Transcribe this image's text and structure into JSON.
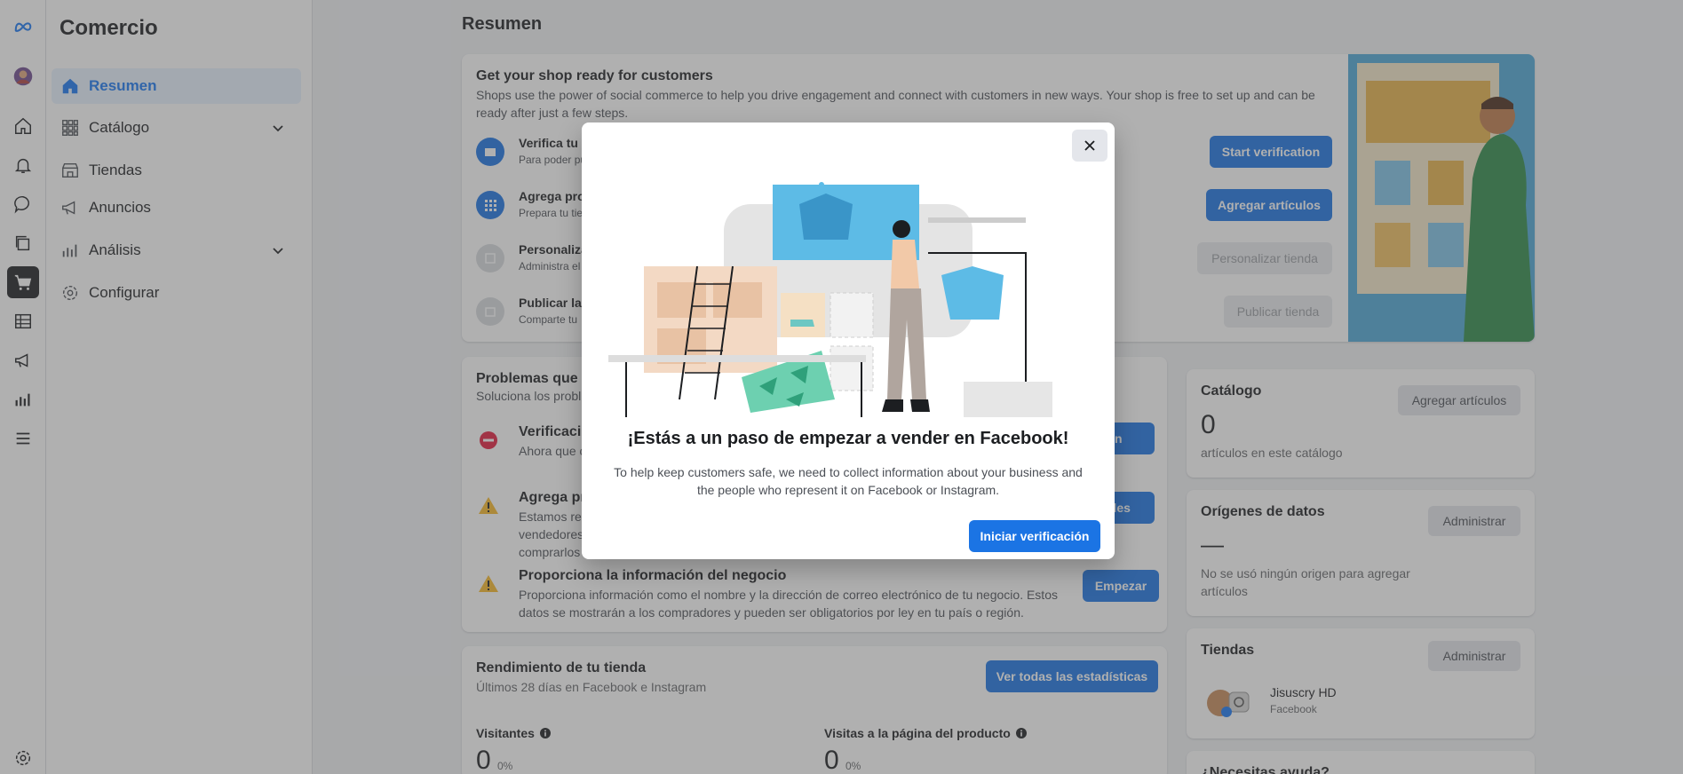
{
  "app": {
    "title": "Comercio"
  },
  "rail": {
    "items": [
      "meta-logo-icon",
      "avatar",
      "home-icon",
      "bell-icon",
      "chat-icon",
      "pages-icon",
      "cart-icon",
      "table-icon",
      "megaphone-icon",
      "chart-icon",
      "menu-icon",
      "settings-icon"
    ]
  },
  "sidebar": {
    "items": [
      {
        "label": "Resumen",
        "icon": "home-icon",
        "active": true
      },
      {
        "label": "Catálogo",
        "icon": "grid-icon",
        "expandable": true
      },
      {
        "label": "Tiendas",
        "icon": "store-icon"
      },
      {
        "label": "Anuncios",
        "icon": "megaphone-icon"
      },
      {
        "label": "Análisis",
        "icon": "bar-chart-icon",
        "expandable": true
      },
      {
        "label": "Configurar",
        "icon": "gear-icon"
      }
    ]
  },
  "main": {
    "title": "Resumen",
    "setup": {
      "title": "Get your shop ready for customers",
      "desc": "Shops use the power of social commerce to help you drive engagement and connect with customers in new ways. Your shop is free to set up and can be ready after just a few steps.",
      "steps": [
        {
          "title": "Verifica tu n",
          "desc": "Para poder pu",
          "button": "Start verification",
          "enabled": true
        },
        {
          "title": "Agrega pro",
          "desc": "Prepara tu tie",
          "button": "Agregar artículos",
          "enabled": true
        },
        {
          "title": "Personaliza",
          "desc": "Administra el",
          "button": "Personalizar tienda",
          "enabled": false
        },
        {
          "title": "Publicar la",
          "desc": "Comparte tu",
          "button": "Publicar tienda",
          "enabled": false
        }
      ]
    },
    "issues": {
      "title": "Problemas que n",
      "subtitle": "Soluciona los probl",
      "items": [
        {
          "title": "Verificaci",
          "desc": "Ahora que c",
          "button": "ón",
          "icon": "error-icon"
        },
        {
          "title": "Agrega pr",
          "desc": "Estamos re\nvendedores\ncomprarlos",
          "button": "talles",
          "icon": "warning-icon"
        },
        {
          "title": "Proporciona la información del negocio",
          "desc": "Proporciona información como el nombre y la dirección de correo electrónico de tu negocio. Estos datos se mostrarán a los compradores y pueden ser obligatorios por ley en tu país o región.",
          "button": "Empezar",
          "icon": "warning-icon"
        }
      ]
    },
    "performance": {
      "title": "Rendimiento de tu tienda",
      "subtitle": "Últimos 28 días en Facebook e Instagram",
      "button": "Ver todas las estadísticas",
      "metrics": [
        {
          "label": "Visitantes",
          "value": "0",
          "pct": "0%"
        },
        {
          "label": "Visitas a la página del producto",
          "value": "0",
          "pct": "0%"
        }
      ]
    },
    "catalog": {
      "title": "Catálogo",
      "button": "Agregar artículos",
      "count": "0",
      "caption": "artículos en este catálogo"
    },
    "datasources": {
      "title": "Orígenes de datos",
      "button": "Administrar",
      "value": "—",
      "caption": "No se usó ningún origen para agregar artículos"
    },
    "shops": {
      "title": "Tiendas",
      "button": "Administrar",
      "shop_name": "Jisuscry HD",
      "shop_platform": "Facebook"
    },
    "help": {
      "title": "¿Necesitas ayuda?"
    }
  },
  "modal": {
    "heading": "¡Estás a un paso de empezar a vender en Facebook!",
    "body": "To help keep customers safe, we need to collect information about your business and the people who represent it on Facebook or Instagram.",
    "button": "Iniciar verificación"
  },
  "colors": {
    "accent": "#1b74e4",
    "background": "#f0f2f5",
    "overlay": "rgba(80,80,80,0.45)"
  }
}
